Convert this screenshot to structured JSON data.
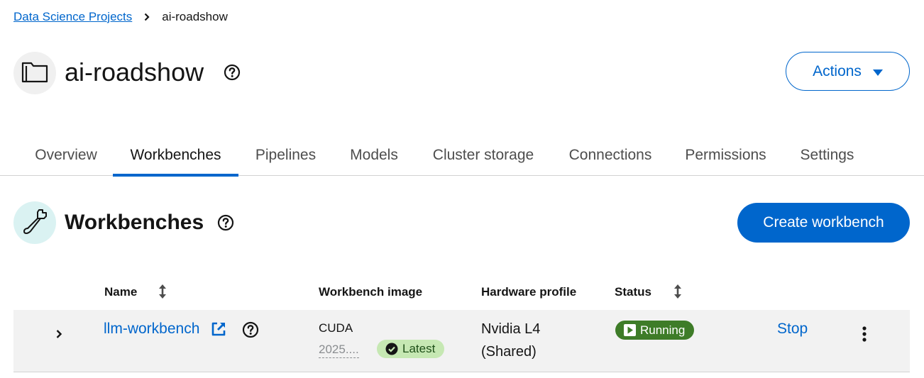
{
  "breadcrumb": {
    "parent": "Data Science Projects",
    "current": "ai-roadshow"
  },
  "project": {
    "title": "ai-roadshow",
    "actions_label": "Actions"
  },
  "tabs": [
    {
      "label": "Overview"
    },
    {
      "label": "Workbenches"
    },
    {
      "label": "Pipelines"
    },
    {
      "label": "Models"
    },
    {
      "label": "Cluster storage"
    },
    {
      "label": "Connections"
    },
    {
      "label": "Permissions"
    },
    {
      "label": "Settings"
    }
  ],
  "active_tab": "Workbenches",
  "section": {
    "title": "Workbenches",
    "create_label": "Create workbench"
  },
  "table": {
    "columns": [
      "Name",
      "Workbench image",
      "Hardware profile",
      "Status"
    ],
    "rows": [
      {
        "name": "llm-workbench",
        "image_name": "CUDA",
        "image_version": "2025....",
        "image_badge": "Latest",
        "hardware_line1": "Nvidia L4",
        "hardware_line2": "(Shared)",
        "status": "Running",
        "action": "Stop"
      }
    ]
  },
  "colors": {
    "accent": "#0066cc",
    "running": "#3e7c28",
    "latest_bg": "#c6e8b3"
  },
  "icons": [
    "chevron-right-icon",
    "folder-icon",
    "help-icon",
    "caret-down-icon",
    "wrench-icon",
    "sort-icon",
    "external-link-icon",
    "check-circle-icon",
    "play-icon",
    "kebab-icon"
  ]
}
